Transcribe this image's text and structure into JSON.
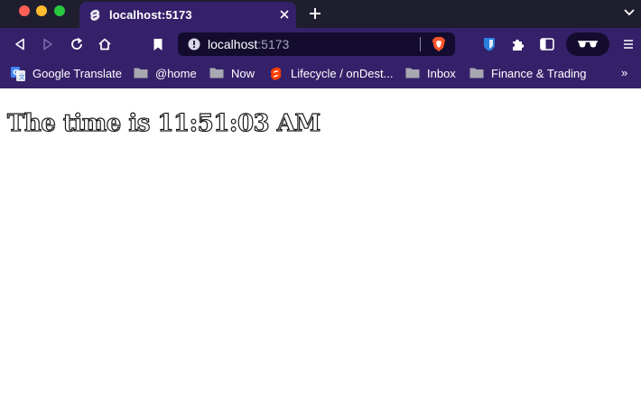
{
  "browser": {
    "tab": {
      "title": "localhost:5173",
      "favicon": "svelte-icon"
    },
    "url": {
      "host": "localhost",
      "port": ":5173"
    },
    "colors": {
      "chrome": "#35216a",
      "titlebar": "#1e1e2f",
      "urlbar": "#130c2e"
    }
  },
  "bookmarks": [
    {
      "label": "Google Translate",
      "icon": "google-translate-icon"
    },
    {
      "label": "@home",
      "icon": "folder-icon"
    },
    {
      "label": "Now",
      "icon": "folder-icon"
    },
    {
      "label": "Lifecycle / onDest...",
      "icon": "svelte-icon"
    },
    {
      "label": "Inbox",
      "icon": "folder-icon"
    },
    {
      "label": "Finance & Trading",
      "icon": "folder-icon"
    }
  ],
  "bookmarks_more": "»",
  "page": {
    "heading": "The time is 11:51:03 AM"
  }
}
